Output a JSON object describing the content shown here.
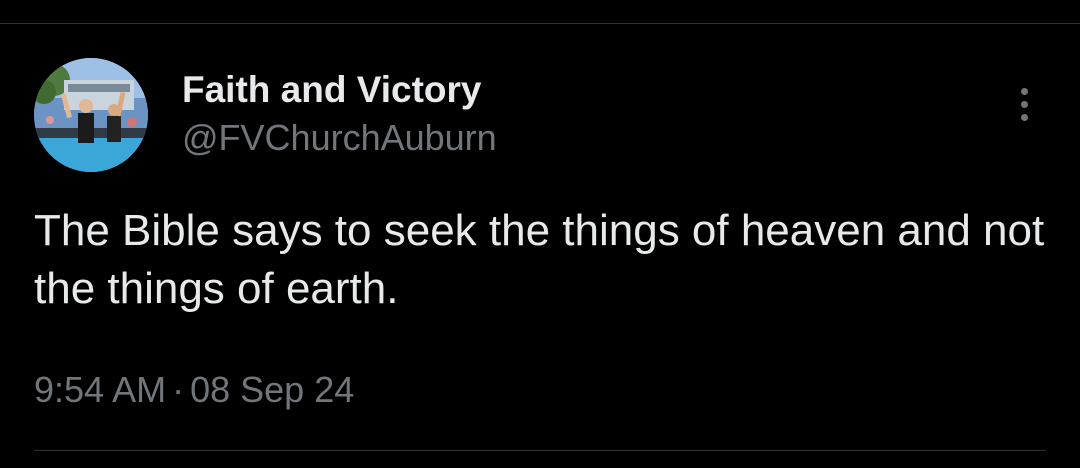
{
  "tweet": {
    "author": {
      "display_name": "Faith and Victory",
      "handle": "@FVChurchAuburn"
    },
    "text": "The Bible says to seek the things of heaven and not the things of earth.",
    "time": "9:54 AM",
    "separator": "·",
    "date": "08 Sep 24",
    "more_icon": "more-vertical-icon"
  },
  "colors": {
    "background": "#000000",
    "primary_text": "#e7e9ea",
    "secondary_text": "#71767b",
    "divider": "#2f3336"
  }
}
